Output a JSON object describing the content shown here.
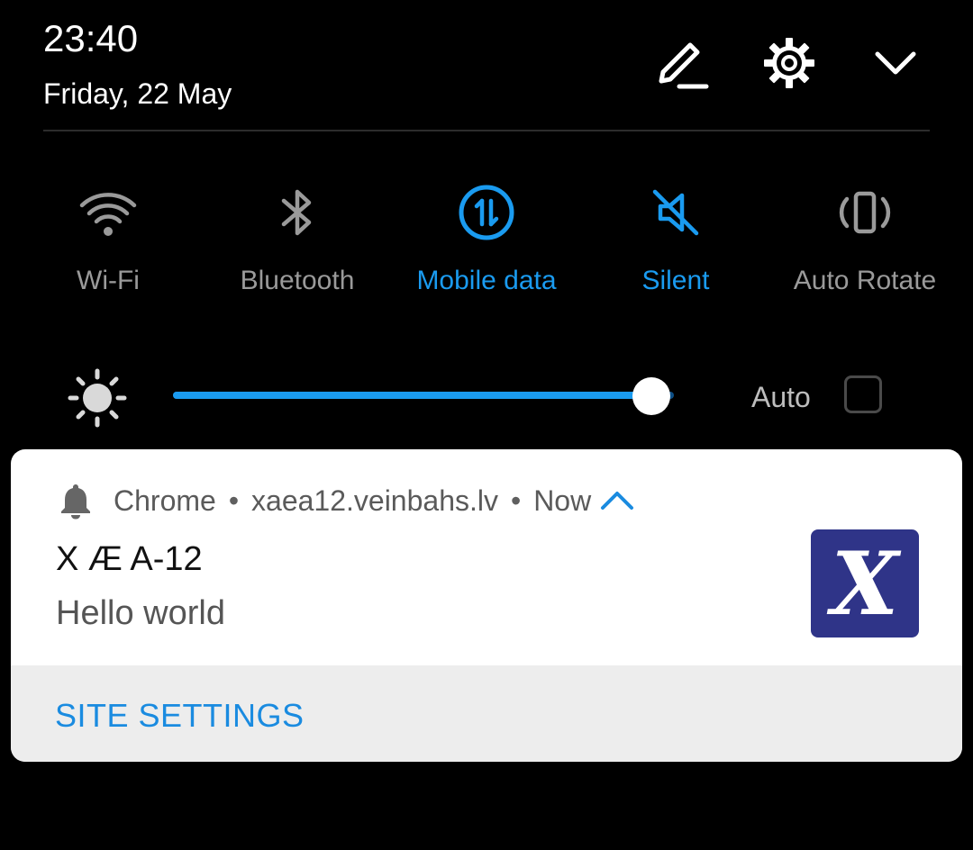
{
  "header": {
    "time": "23:40",
    "date": "Friday, 22 May"
  },
  "quick_tiles": [
    {
      "label": "Wi-Fi",
      "state": "off",
      "icon": "wifi-icon"
    },
    {
      "label": "Bluetooth",
      "state": "off",
      "icon": "bluetooth-icon"
    },
    {
      "label": "Mobile data",
      "state": "on",
      "icon": "mobile-data-icon"
    },
    {
      "label": "Silent",
      "state": "on",
      "icon": "silent-icon"
    },
    {
      "label": "Auto Rotate",
      "state": "off",
      "icon": "auto-rotate-icon"
    }
  ],
  "brightness": {
    "level": 0.955,
    "auto_label": "Auto",
    "auto_checked": false
  },
  "notification": {
    "app": "Chrome",
    "separator": "•",
    "site": "xaea12.veinbahs.lv",
    "when": "Now",
    "title": "X Æ A-12",
    "body": "Hello world",
    "action_label": "SITE SETTINGS",
    "logo_letter": "X",
    "logo_color": "#2f3488"
  },
  "colors": {
    "accent": "#1a9bf0",
    "inactive": "#9a9a9a"
  }
}
